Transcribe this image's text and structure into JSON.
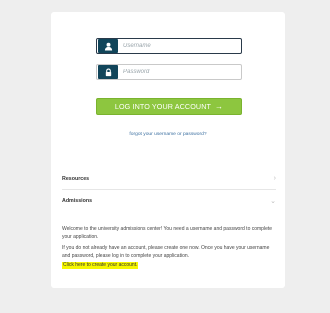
{
  "login": {
    "username_placeholder": "Username",
    "password_placeholder": "Password",
    "submit_label": "LOG INTO YOUR ACCOUNT",
    "submit_arrow": "→",
    "forgot_link": "forgot your username or password?"
  },
  "sections": {
    "resources": {
      "title": "Resources",
      "chevron": "›"
    },
    "admissions": {
      "title": "Admissions",
      "chevron": "⌄",
      "paragraph_1": "Welcome to the university admissions center! You need a username and password to complete your application.",
      "paragraph_2": "If you do not already have an account, please create one now. Once you have your username and password, please log in to complete your application.",
      "create_account_link": "Click here to create your account."
    }
  },
  "colors": {
    "page_background": "#eeeeee",
    "icon_background": "#11455a",
    "button_green": "#8dc63f",
    "link_blue": "#3b6fa0",
    "highlight_yellow": "#f6f700"
  },
  "icons": {
    "username": "user-icon",
    "password": "lock-icon"
  }
}
